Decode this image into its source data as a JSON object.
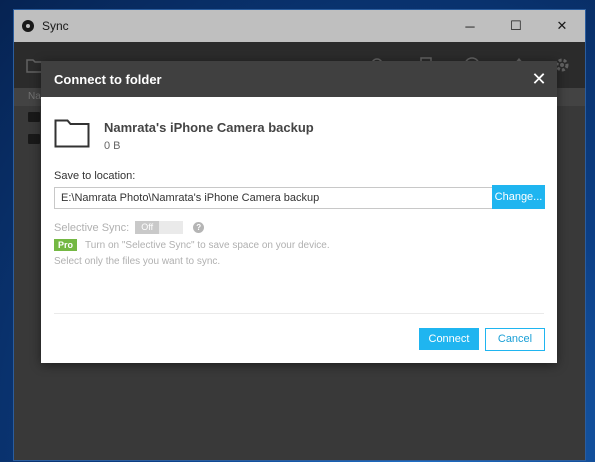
{
  "app": {
    "title": "Sync",
    "window_controls": [
      "─",
      "☐",
      "✕"
    ]
  },
  "background_list": {
    "header_label": "Na"
  },
  "dialog": {
    "title": "Connect to folder",
    "close_label": "✕",
    "folder_name": "Namrata's iPhone Camera backup",
    "folder_size": "0 B",
    "save_label": "Save to location:",
    "path_value": "E:\\Namrata Photo\\Namrata's iPhone Camera backup",
    "change_button": "Change...",
    "selective_sync_label": "Selective Sync:",
    "toggle_state": "Off",
    "help_glyph": "?",
    "pro_badge": "Pro",
    "pro_text": "Turn on \"Selective Sync\" to save space on your device.",
    "pro_text2": "Select only the files you want to sync.",
    "connect_button": "Connect",
    "cancel_button": "Cancel"
  },
  "colors": {
    "accent": "#1fb5f0",
    "pro_green": "#74b843",
    "dialog_header": "#404040"
  }
}
